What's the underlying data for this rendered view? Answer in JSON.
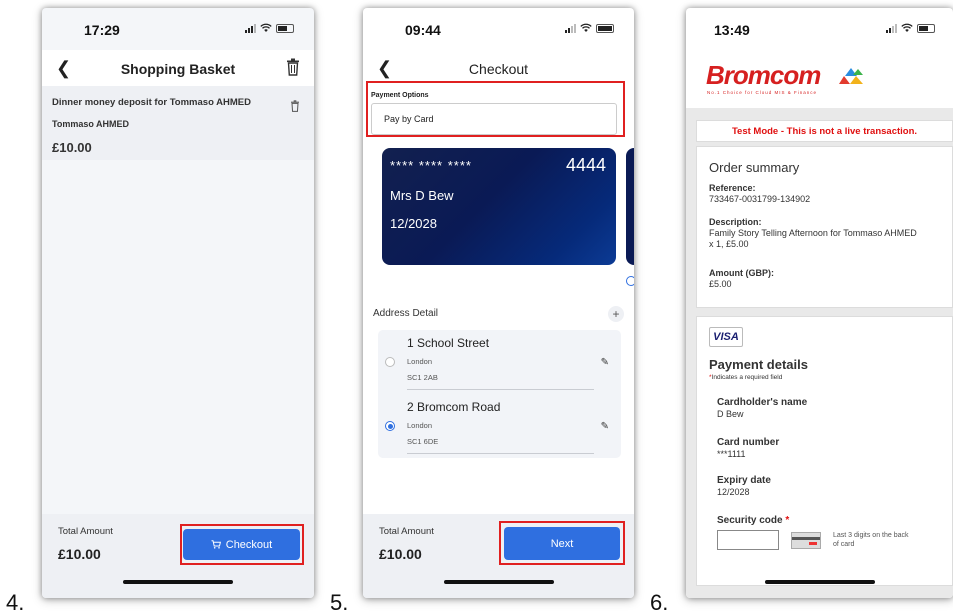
{
  "steps": [
    "4.",
    "5.",
    "6."
  ],
  "screen4": {
    "time": "17:29",
    "title": "Shopping Basket",
    "item": {
      "description": "Dinner money deposit for Tommaso AHMED",
      "pupil": "Tommaso AHMED",
      "price": "£10.00"
    },
    "total_label": "Total Amount",
    "total_value": "£10.00",
    "checkout_label": "Checkout",
    "accent": "#2f6fe0",
    "highlight": "#e02020"
  },
  "screen5": {
    "time": "09:44",
    "title": "Checkout",
    "payment_options_label": "Payment Options",
    "payment_option_value": "Pay by Card",
    "card": {
      "masked": "****   ****   ****",
      "last4": "4444",
      "holder": "Mrs D Bew",
      "expiry": "12/2028"
    },
    "address_detail_label": "Address Detail",
    "addresses": [
      {
        "line1": "1 School Street",
        "town": "London",
        "postcode": "SC1 2AB",
        "selected": false
      },
      {
        "line1": "2 Bromcom Road",
        "town": "London",
        "postcode": "SC1 6DE",
        "selected": true
      }
    ],
    "total_label": "Total Amount",
    "total_value": "£10.00",
    "next_label": "Next"
  },
  "screen6": {
    "time": "13:49",
    "logo_text": "Bromcom",
    "logo_tagline": "No.1 Choice for Cloud MIS & Finance",
    "test_mode": "Test Mode - This is not a live transaction.",
    "order_summary_title": "Order summary",
    "reference_label": "Reference:",
    "reference_value": "733467-0031799-134902",
    "description_label": "Description:",
    "description_value": "Family Story Telling Afternoon for Tommaso AHMED x 1, £5.00",
    "amount_label": "Amount (GBP):",
    "amount_value": "£5.00",
    "card_brand": "VISA",
    "payment_details_title": "Payment details",
    "required_note": "Indicates a required field",
    "required_marker": "*",
    "cardholder_label": "Cardholder's name",
    "cardholder_value": "D Bew",
    "card_number_label": "Card number",
    "card_number_value": "***1111",
    "expiry_label": "Expiry date",
    "expiry_value": "12/2028",
    "security_code_label": "Security code",
    "security_hint": "Last 3 digits on the back of card"
  }
}
